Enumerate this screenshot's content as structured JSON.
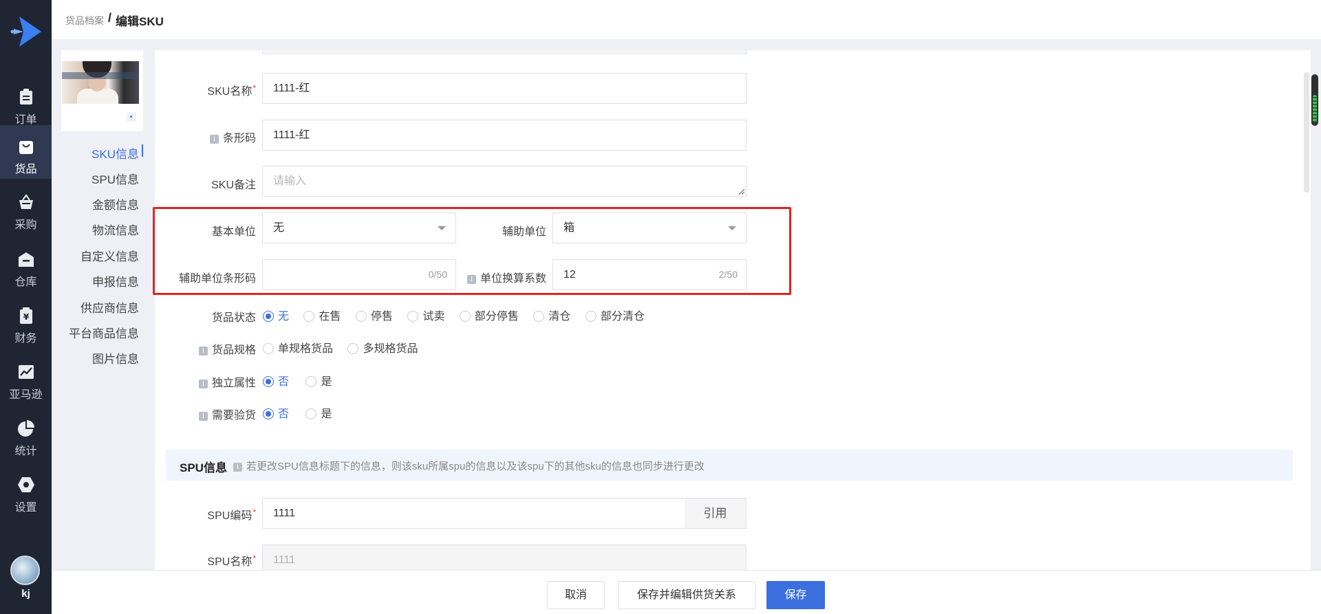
{
  "nav": {
    "items": [
      {
        "label": "订单",
        "icon": "clipboard-icon"
      },
      {
        "label": "货品",
        "icon": "shopping-bag-icon"
      },
      {
        "label": "采购",
        "icon": "basket-icon"
      },
      {
        "label": "仓库",
        "icon": "warehouse-icon"
      },
      {
        "label": "财务",
        "icon": "yuan-wallet-icon"
      },
      {
        "label": "亚马逊",
        "icon": "trend-chart-icon"
      },
      {
        "label": "统计",
        "icon": "pie-chart-icon"
      },
      {
        "label": "设置",
        "icon": "gear-icon"
      }
    ],
    "active_index": 1,
    "user": "kj"
  },
  "breadcrumb": {
    "parent": "货品档案",
    "separator": "/",
    "current": "编辑SKU"
  },
  "anchors": [
    "SKU信息",
    "SPU信息",
    "金额信息",
    "物流信息",
    "自定义信息",
    "申报信息",
    "供应商信息",
    "平台商品信息",
    "图片信息"
  ],
  "form": {
    "sku_name": {
      "label": "SKU名称",
      "required": "*",
      "value": "1111-红"
    },
    "barcode": {
      "label": "条形码",
      "value": "1111-红"
    },
    "sku_remark": {
      "label": "SKU备注",
      "placeholder": "请输入"
    },
    "base_unit": {
      "label": "基本单位",
      "value": "无"
    },
    "aux_unit": {
      "label": "辅助单位",
      "value": "箱"
    },
    "aux_unit_barcode": {
      "label": "辅助单位条形码",
      "value": "",
      "counter": "0/50"
    },
    "conversion_factor": {
      "label": "单位换算系数",
      "value": "12",
      "counter": "2/50"
    },
    "goods_status": {
      "label": "货品状态",
      "options": [
        "无",
        "在售",
        "停售",
        "试卖",
        "部分停售",
        "清仓",
        "部分清仓"
      ],
      "selected": "无"
    },
    "goods_spec": {
      "label": "货品规格",
      "options": [
        "单规格货品",
        "多规格货品"
      ],
      "selected": ""
    },
    "independent_attr": {
      "label": "独立属性",
      "options": [
        "否",
        "是"
      ],
      "selected": "否"
    },
    "need_inspection": {
      "label": "需要验货",
      "options": [
        "否",
        "是"
      ],
      "selected": "否"
    }
  },
  "spu_section": {
    "title": "SPU信息",
    "note": "若更改SPU信息标题下的信息，则该sku所属spu的信息以及该spu下的其他sku的信息也同步进行更改",
    "spu_code": {
      "label": "SPU编码",
      "required": "*",
      "value": "1111",
      "button": "引用"
    },
    "spu_name": {
      "label": "SPU名称",
      "required": "*",
      "value": "1111"
    }
  },
  "footer": {
    "cancel": "取消",
    "save_and_edit": "保存并编辑供货关系",
    "save": "保存"
  },
  "colors": {
    "accent": "#3b6fe0",
    "nav_bg": "#1f2533",
    "highlight": "#e52222"
  }
}
